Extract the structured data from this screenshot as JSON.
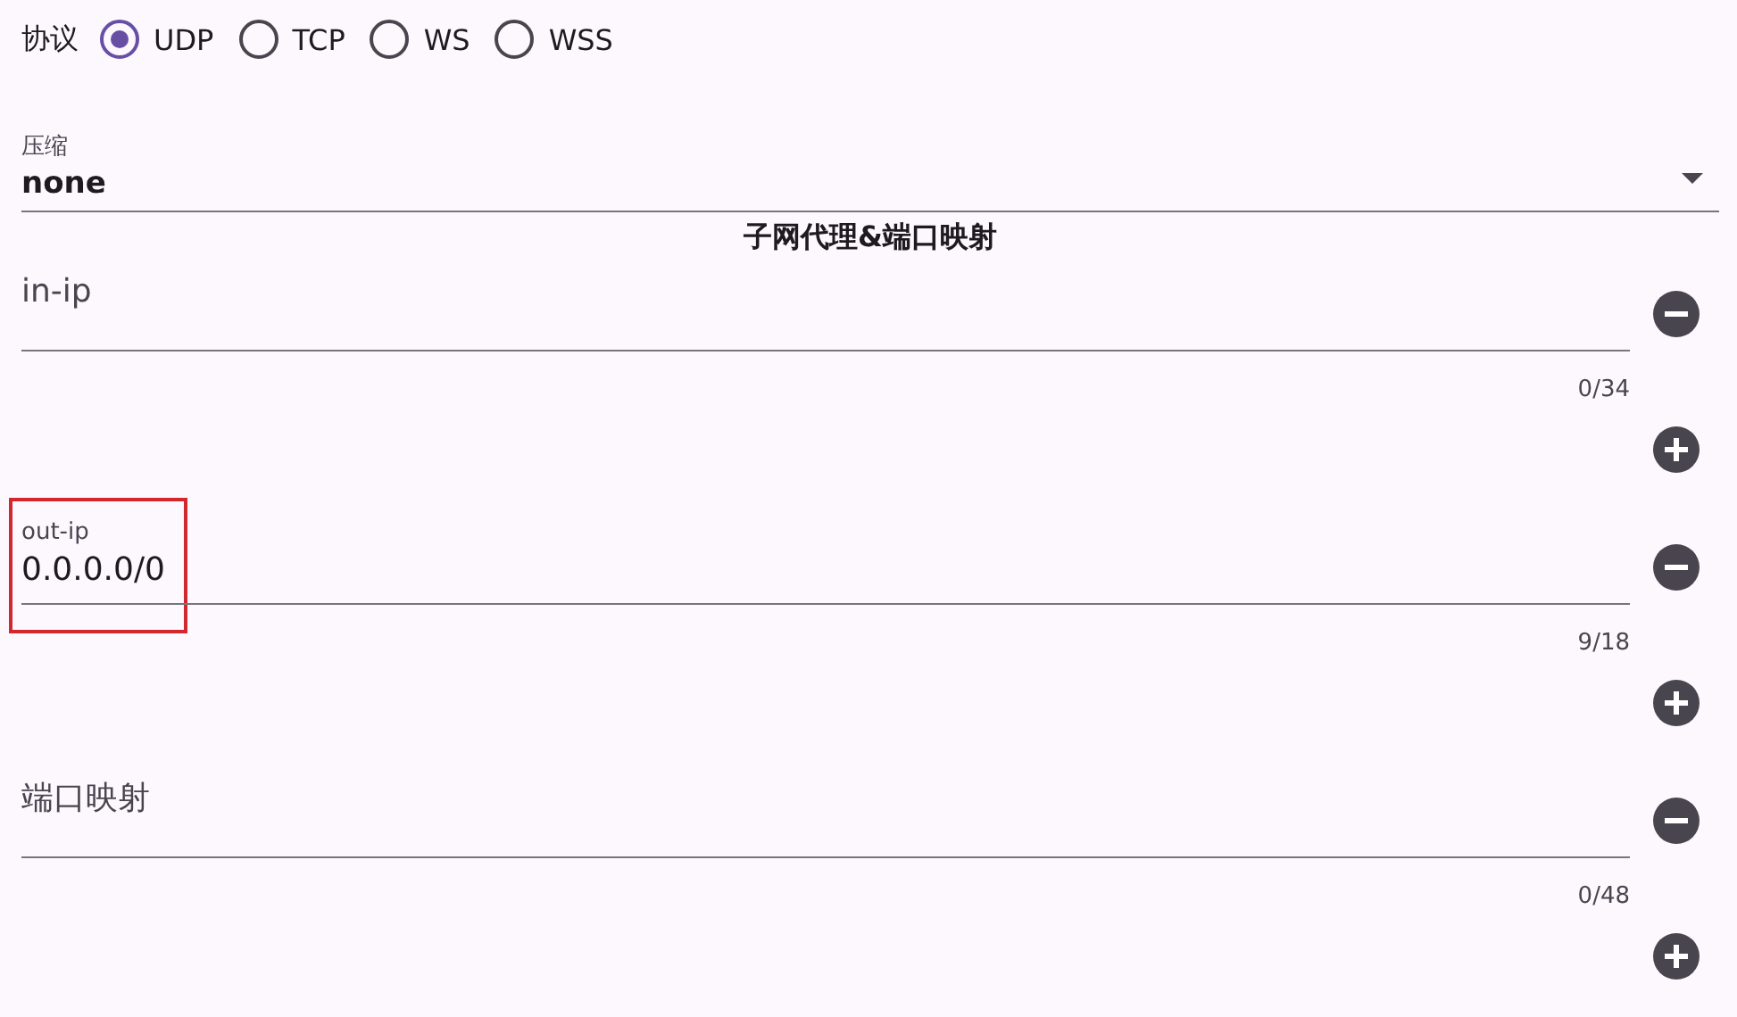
{
  "protocol": {
    "label": "协议",
    "options": [
      {
        "label": "UDP",
        "selected": true
      },
      {
        "label": "TCP",
        "selected": false
      },
      {
        "label": "WS",
        "selected": false
      },
      {
        "label": "WSS",
        "selected": false
      }
    ]
  },
  "compression": {
    "label": "压缩",
    "value": "none"
  },
  "section_title": "子网代理&端口映射",
  "fields": [
    {
      "placeholder": "in-ip",
      "counter": "0/34",
      "highlighted": false
    },
    {
      "label": "out-ip",
      "value": "0.0.0.0/0",
      "counter": "9/18",
      "highlighted": true
    },
    {
      "placeholder": "端口映射",
      "counter": "0/48",
      "highlighted": false
    }
  ]
}
